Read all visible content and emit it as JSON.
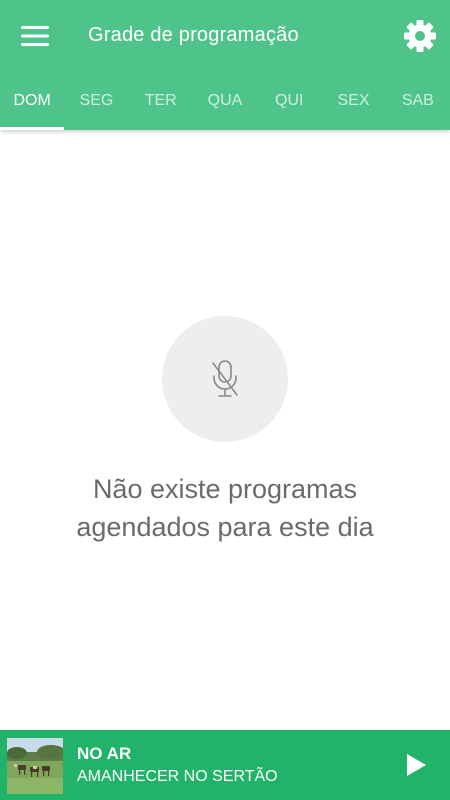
{
  "app": {
    "title": "Grade de programação",
    "accent_color": "#4fc48a",
    "player_color": "#22b36b"
  },
  "toolbar": {
    "menu_icon": "hamburger-menu-icon",
    "settings_icon": "gear-icon"
  },
  "tabs": [
    {
      "label": "DOM",
      "active": true
    },
    {
      "label": "SEG",
      "active": false
    },
    {
      "label": "TER",
      "active": false
    },
    {
      "label": "QUA",
      "active": false
    },
    {
      "label": "QUI",
      "active": false
    },
    {
      "label": "SEX",
      "active": false
    },
    {
      "label": "SAB",
      "active": false
    }
  ],
  "empty_state": {
    "icon": "microphone-off-icon",
    "message": "Não existe programas agendados para este dia"
  },
  "player": {
    "thumbnail": "farm-landscape-thumbnail",
    "status_label": "NO AR",
    "show_name": "AMANHECER NO SERTÃO",
    "play_icon": "play-icon"
  }
}
